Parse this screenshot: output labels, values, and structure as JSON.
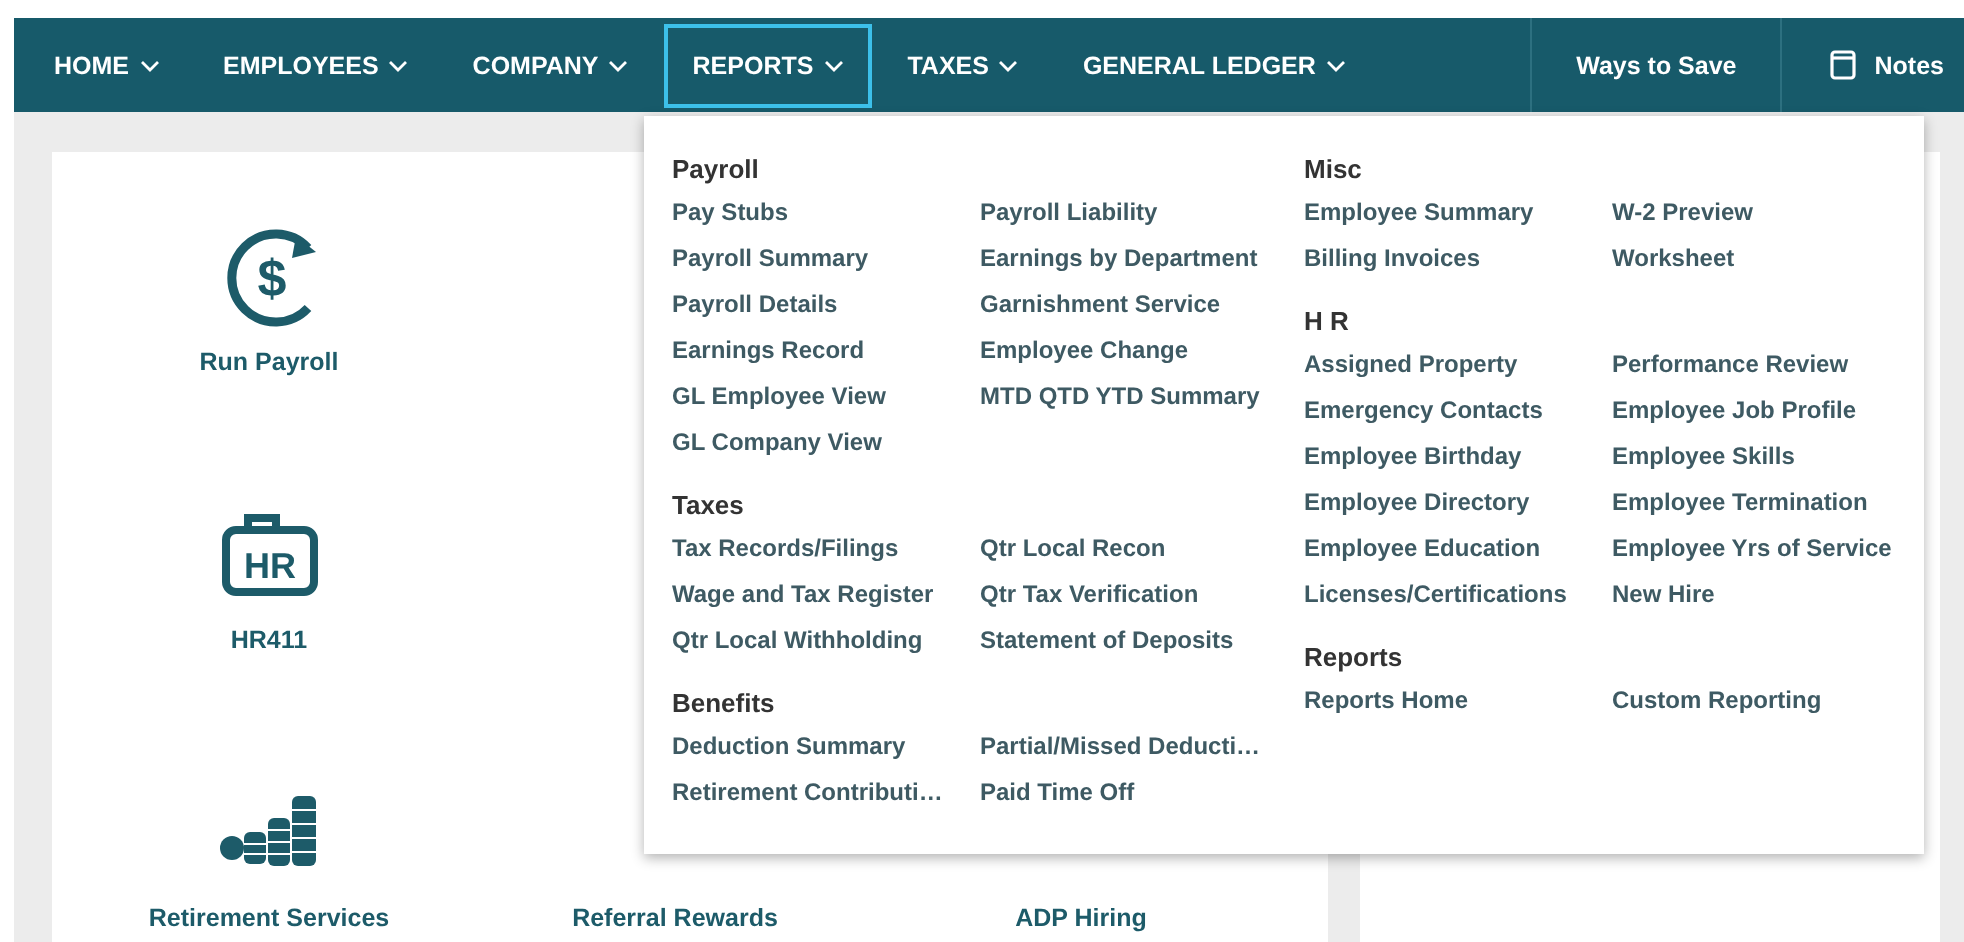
{
  "nav": {
    "items": [
      {
        "label": "HOME",
        "selected": false
      },
      {
        "label": "EMPLOYEES",
        "selected": false
      },
      {
        "label": "COMPANY",
        "selected": false
      },
      {
        "label": "REPORTS",
        "selected": true
      },
      {
        "label": "TAXES",
        "selected": false
      },
      {
        "label": "GENERAL LEDGER",
        "selected": false
      }
    ],
    "ways_to_save": "Ways to Save",
    "notes": "Notes"
  },
  "tile_rows": [
    [
      {
        "label": "Run Payroll",
        "kind": "payroll",
        "icon_text": "$"
      }
    ],
    [
      {
        "label": "HR411",
        "kind": "hr",
        "icon_text": "HR"
      }
    ],
    [
      {
        "label": "Retirement Services",
        "kind": "coins"
      },
      {
        "label": "Referral Rewards"
      },
      {
        "label": "ADP Hiring"
      }
    ]
  ],
  "menu": {
    "columns": [
      {
        "sections": [
          {
            "title": "Payroll",
            "items": [
              "Pay Stubs",
              "Payroll Liability",
              "Payroll Summary",
              "Earnings by Department",
              "Payroll Details",
              "Garnishment Service",
              "Earnings Record",
              "Employee Change",
              "GL Employee View",
              "MTD QTD YTD Summary",
              "GL Company View"
            ]
          },
          {
            "title": "Taxes",
            "items": [
              "Tax Records/Filings",
              "Qtr Local Recon",
              "Wage and Tax Register",
              "Qtr Tax Verification",
              "Qtr Local Withholding",
              "Statement of Deposits"
            ]
          },
          {
            "title": "Benefits",
            "items": [
              "Deduction Summary",
              "Partial/Missed Deducti…",
              "Retirement Contributi…",
              "Paid Time Off"
            ]
          }
        ]
      },
      {
        "sections": [
          {
            "title": "Misc",
            "items": [
              "Employee Summary",
              "W-2 Preview",
              "Billing Invoices",
              "Worksheet"
            ]
          },
          {
            "title": "H R",
            "items": [
              "Assigned Property",
              "Performance Review",
              "Emergency Contacts",
              "Employee Job Profile",
              "Employee Birthday",
              "Employee Skills",
              "Employee Directory",
              "Employee Termination",
              "Employee Education",
              "Employee Yrs of Service",
              "Licenses/Certifications",
              "New Hire"
            ]
          },
          {
            "title": "Reports",
            "items": [
              "Reports Home",
              "Custom Reporting"
            ]
          }
        ]
      }
    ]
  }
}
